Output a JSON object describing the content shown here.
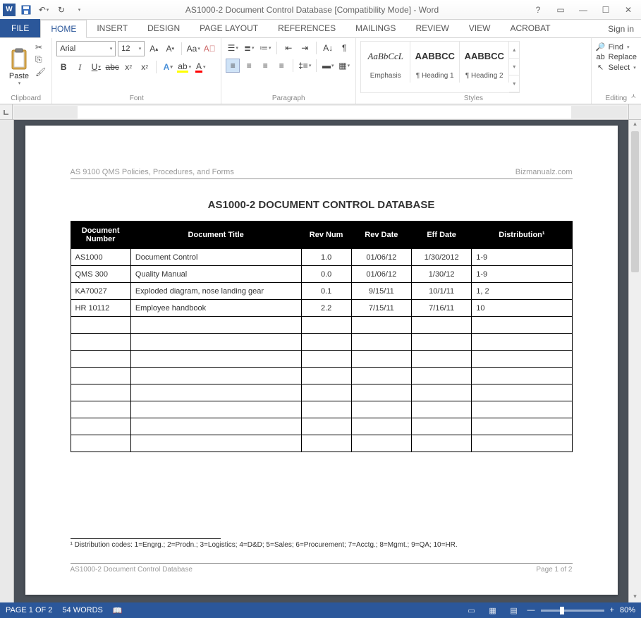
{
  "title": "AS1000-2 Document Control Database [Compatibility Mode] - Word",
  "signin": "Sign in",
  "tabs": {
    "file": "FILE",
    "home": "HOME",
    "insert": "INSERT",
    "design": "DESIGN",
    "pagelayout": "PAGE LAYOUT",
    "references": "REFERENCES",
    "mailings": "MAILINGS",
    "review": "REVIEW",
    "view": "VIEW",
    "acrobat": "ACROBAT"
  },
  "ribbon": {
    "clipboard": {
      "label": "Clipboard",
      "paste": "Paste"
    },
    "font": {
      "label": "Font",
      "name": "Arial",
      "size": "12"
    },
    "paragraph": {
      "label": "Paragraph"
    },
    "styles": {
      "label": "Styles",
      "items": [
        {
          "sample": "AaBbCcL",
          "name": "Emphasis"
        },
        {
          "sample": "AABBCC",
          "name": "¶ Heading 1"
        },
        {
          "sample": "AABBCC",
          "name": "¶ Heading 2"
        }
      ]
    },
    "editing": {
      "label": "Editing",
      "find": "Find",
      "replace": "Replace",
      "select": "Select"
    }
  },
  "document": {
    "header_left": "AS 9100 QMS Policies, Procedures, and Forms",
    "header_right": "Bizmanualz.com",
    "title": "AS1000-2 DOCUMENT CONTROL DATABASE",
    "columns": [
      "Document Number",
      "Document Title",
      "Rev Num",
      "Rev Date",
      "Eff Date",
      "Distribution¹"
    ],
    "rows": [
      {
        "num": "AS1000",
        "title": "Document Control",
        "rev": "1.0",
        "rdate": "01/06/12",
        "edate": "1/30/2012",
        "dist": "1-9"
      },
      {
        "num": "QMS 300",
        "title": "Quality Manual",
        "rev": "0.0",
        "rdate": "01/06/12",
        "edate": "1/30/12",
        "dist": "1-9"
      },
      {
        "num": "KA70027",
        "title": "Exploded diagram, nose landing gear",
        "rev": "0.1",
        "rdate": "9/15/11",
        "edate": "10/1/11",
        "dist": "1, 2"
      },
      {
        "num": "HR 10112",
        "title": "Employee handbook",
        "rev": "2.2",
        "rdate": "7/15/11",
        "edate": "7/16/11",
        "dist": "10"
      }
    ],
    "footnote": "¹ Distribution codes: 1=Engrg.; 2=Prodn.; 3=Logistics; 4=D&D; 5=Sales; 6=Procurement; 7=Acctg.; 8=Mgmt.; 9=QA; 10=HR.",
    "footer_left": "AS1000-2 Document Control Database",
    "footer_right": "Page 1 of 2"
  },
  "status": {
    "page": "PAGE 1 OF 2",
    "words": "54 WORDS",
    "zoom": "80%"
  }
}
